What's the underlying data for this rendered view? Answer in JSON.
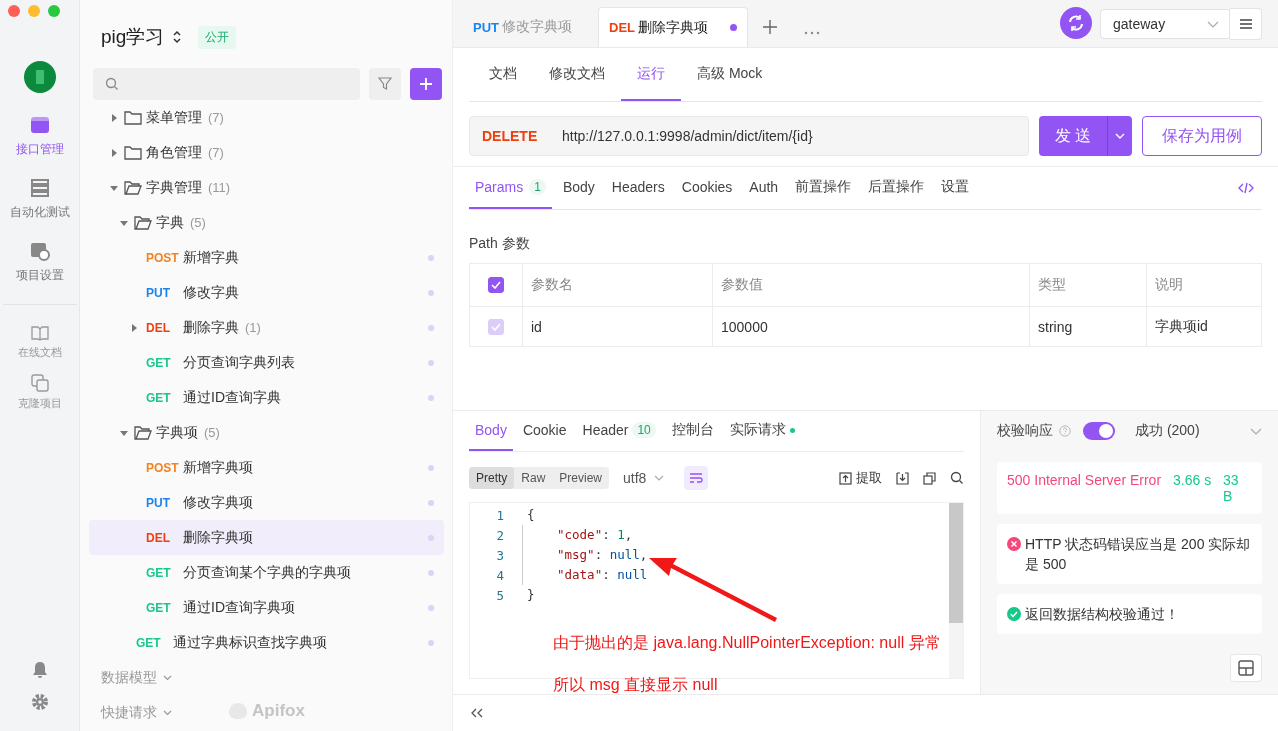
{
  "rail": {
    "main_items": [
      {
        "label": "接口管理",
        "kind": "api",
        "selected": true
      },
      {
        "label": "自动化测试",
        "kind": "automation",
        "selected": false
      },
      {
        "label": "项目设置",
        "kind": "settings",
        "selected": false
      }
    ],
    "extra_items": [
      {
        "label": "在线文档",
        "kind": "docs"
      },
      {
        "label": "克隆项目",
        "kind": "clone"
      }
    ]
  },
  "sidebar": {
    "project": "pig学习",
    "badge": "公开",
    "tree": [
      {
        "kind": "folder",
        "name": "菜单管理",
        "count": "(7)",
        "expanded": false
      },
      {
        "kind": "folder",
        "name": "角色管理",
        "count": "(7)",
        "expanded": false
      },
      {
        "kind": "folder",
        "name": "字典管理",
        "count": "(11)",
        "expanded": true,
        "children": [
          {
            "kind": "folder",
            "name": "字典",
            "count": "(5)",
            "expanded": true,
            "children": [
              {
                "kind": "api",
                "method": "POST",
                "color": "#f5811f",
                "name": "新增字典",
                "selected": false
              },
              {
                "kind": "api",
                "method": "PUT",
                "color": "#1a84ee",
                "name": "修改字典",
                "selected": false
              },
              {
                "kind": "api",
                "method": "DEL",
                "color": "#ee3f0f",
                "name": "删除字典",
                "count": "(1)",
                "expanded": false,
                "selected": false
              },
              {
                "kind": "api",
                "method": "GET",
                "color": "#17c88a",
                "name": "分页查询字典列表",
                "selected": false
              },
              {
                "kind": "api",
                "method": "GET",
                "color": "#17c88a",
                "name": "通过ID查询字典",
                "selected": false
              }
            ]
          },
          {
            "kind": "folder",
            "name": "字典项",
            "count": "(5)",
            "expanded": true,
            "children": [
              {
                "kind": "api",
                "method": "POST",
                "color": "#f5811f",
                "name": "新增字典项",
                "selected": false
              },
              {
                "kind": "api",
                "method": "PUT",
                "color": "#1a84ee",
                "name": "修改字典项",
                "selected": false
              },
              {
                "kind": "api",
                "method": "DEL",
                "color": "#ee3f0f",
                "name": "删除字典项",
                "selected": true
              },
              {
                "kind": "api",
                "method": "GET",
                "color": "#17c88a",
                "name": "分页查询某个字典的字典项",
                "selected": false
              },
              {
                "kind": "api",
                "method": "GET",
                "color": "#17c88a",
                "name": "通过ID查询字典项",
                "selected": false
              }
            ]
          },
          {
            "kind": "api",
            "method": "GET",
            "color": "#17c88a",
            "name": "通过字典标识查找字典项",
            "selected": false
          }
        ]
      }
    ],
    "sections": [
      "数据模型",
      "快捷请求"
    ],
    "brand": "Apifox"
  },
  "tabs": [
    {
      "method": "PUT",
      "color": "#1a84ee",
      "title": "修改字典项",
      "selected": false,
      "modified": false
    },
    {
      "method": "DEL",
      "color": "#ee3f0f",
      "title": "删除字典项",
      "selected": true,
      "modified": true
    }
  ],
  "environment": "gateway",
  "subtabs": [
    {
      "label": "文档",
      "selected": false
    },
    {
      "label": "修改文档",
      "selected": false
    },
    {
      "label": "运行",
      "selected": true
    },
    {
      "label": "高级 Mock",
      "selected": false
    }
  ],
  "request": {
    "method": "DELETE",
    "url": "http://127.0.0.1:9998/admin/dict/item/{id}",
    "send": "发 送",
    "save": "保存为用例"
  },
  "param_tabs": [
    {
      "label": "Params",
      "count": "1",
      "selected": true
    },
    {
      "label": "Body",
      "selected": false
    },
    {
      "label": "Headers",
      "selected": false
    },
    {
      "label": "Cookies",
      "selected": false
    },
    {
      "label": "Auth",
      "selected": false
    },
    {
      "label": "前置操作",
      "selected": false
    },
    {
      "label": "后置操作",
      "selected": false
    },
    {
      "label": "设置",
      "selected": false
    }
  ],
  "path_params": {
    "title": "Path 参数",
    "all_checked": true,
    "columns": [
      "参数名",
      "参数值",
      "类型",
      "说明"
    ],
    "rows": [
      {
        "checked": true,
        "disabled": true,
        "cells": [
          "id",
          "100000",
          "string",
          "字典项id"
        ]
      }
    ]
  },
  "response": {
    "tabs": [
      {
        "label": "Body",
        "selected": true
      },
      {
        "label": "Cookie",
        "selected": false
      },
      {
        "label": "Header",
        "count": "10",
        "selected": false
      },
      {
        "label": "控制台",
        "selected": false
      },
      {
        "label": "实际请求",
        "dot": true,
        "selected": false
      }
    ],
    "formats": [
      {
        "label": "Pretty",
        "selected": true
      },
      {
        "label": "Raw",
        "selected": false
      },
      {
        "label": "Preview",
        "selected": false
      }
    ],
    "encoding": "utf8",
    "extract": "提取",
    "code": [
      {
        "n": "1",
        "indent": false,
        "tokens": [
          {
            "t": "{",
            "kind": "punct"
          }
        ]
      },
      {
        "n": "2",
        "indent": true,
        "tokens": [
          {
            "t": "\"code\"",
            "kind": "key"
          },
          {
            "t": ": ",
            "kind": "punct"
          },
          {
            "t": "1",
            "kind": "number"
          },
          {
            "t": ",",
            "kind": "punct"
          }
        ]
      },
      {
        "n": "3",
        "indent": true,
        "tokens": [
          {
            "t": "\"msg\"",
            "kind": "key"
          },
          {
            "t": ": ",
            "kind": "punct"
          },
          {
            "t": "null",
            "kind": "null"
          },
          {
            "t": ",",
            "kind": "punct"
          }
        ]
      },
      {
        "n": "4",
        "indent": true,
        "tokens": [
          {
            "t": "\"data\"",
            "kind": "key"
          },
          {
            "t": ": ",
            "kind": "punct"
          },
          {
            "t": "null",
            "kind": "null"
          }
        ]
      },
      {
        "n": "5",
        "indent": false,
        "tokens": [
          {
            "t": "}",
            "kind": "punct"
          }
        ]
      }
    ]
  },
  "validation": {
    "label": "校验响应",
    "enabled": true,
    "result": "成功 (200)",
    "status": "500 Internal Server Error",
    "time": "3.66 s",
    "size": "33 B",
    "messages": [
      {
        "kind": "error",
        "text": "HTTP 状态码错误应当是 200 实际却是 500"
      },
      {
        "kind": "ok",
        "text": "返回数据结构校验通过！"
      }
    ]
  },
  "annotation": [
    "由于抛出的是 java.lang.NullPointerException: null 异常",
    "所以 msg 直接显示 null"
  ]
}
